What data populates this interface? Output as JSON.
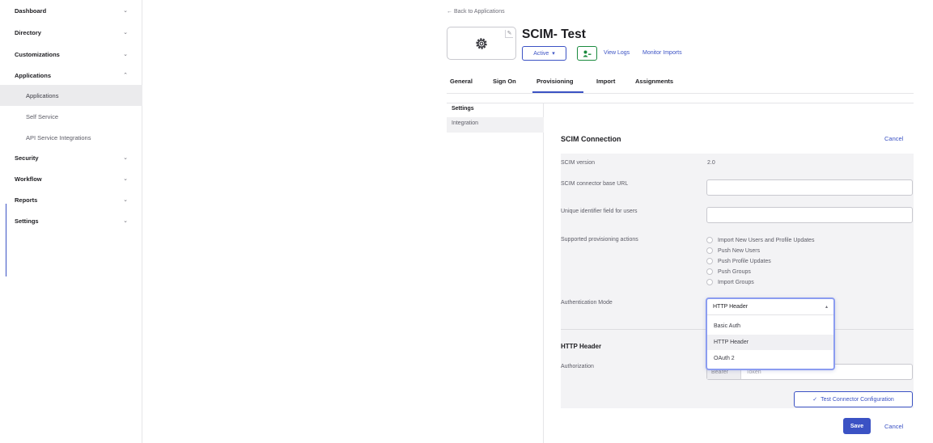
{
  "sidebar": {
    "items": [
      {
        "label": "Dashboard",
        "chevron": "⌄"
      },
      {
        "label": "Directory",
        "chevron": "⌄"
      },
      {
        "label": "Customizations",
        "chevron": "⌄"
      },
      {
        "label": "Applications",
        "chevron": "⌃"
      },
      {
        "label": "Security",
        "chevron": "⌄"
      },
      {
        "label": "Workflow",
        "chevron": "⌄"
      },
      {
        "label": "Reports",
        "chevron": "⌄"
      },
      {
        "label": "Settings",
        "chevron": "⌄"
      }
    ],
    "sub_items": [
      "Applications",
      "Self Service",
      "API Service Integrations"
    ]
  },
  "header": {
    "back_link": "← Back to Applications",
    "app_title": "SCIM- Test",
    "status": "Active",
    "status_caret": "▾",
    "view_logs": "View Logs",
    "monitor_imports": "Monitor Imports",
    "edit_icon": "✎"
  },
  "tabs": [
    "General",
    "Sign On",
    "Provisioning",
    "Import",
    "Assignments"
  ],
  "settings_nav": {
    "heading": "Settings",
    "item": "Integration"
  },
  "scim": {
    "title": "SCIM Connection",
    "cancel": "Cancel",
    "version_label": "SCIM version",
    "version_value": "2.0",
    "base_url_label": "SCIM connector base URL",
    "unique_id_label": "Unique identifier field for users",
    "actions_label": "Supported provisioning actions",
    "actions": [
      "Import New Users and Profile Updates",
      "Push New Users",
      "Push Profile Updates",
      "Push Groups",
      "Import Groups"
    ],
    "auth_mode_label": "Authentication Mode",
    "auth_mode_selected": "HTTP Header",
    "auth_mode_caret": "▴",
    "auth_mode_options": [
      "Basic Auth",
      "HTTP Header",
      "OAuth 2"
    ],
    "http_header_title": "HTTP Header",
    "authorization_label": "Authorization",
    "authorization_prefix": "Bearer",
    "authorization_placeholder": "Token",
    "test_button": "Test Connector Configuration",
    "test_icon": "✓",
    "save": "Save",
    "cancel_bottom": "Cancel"
  }
}
